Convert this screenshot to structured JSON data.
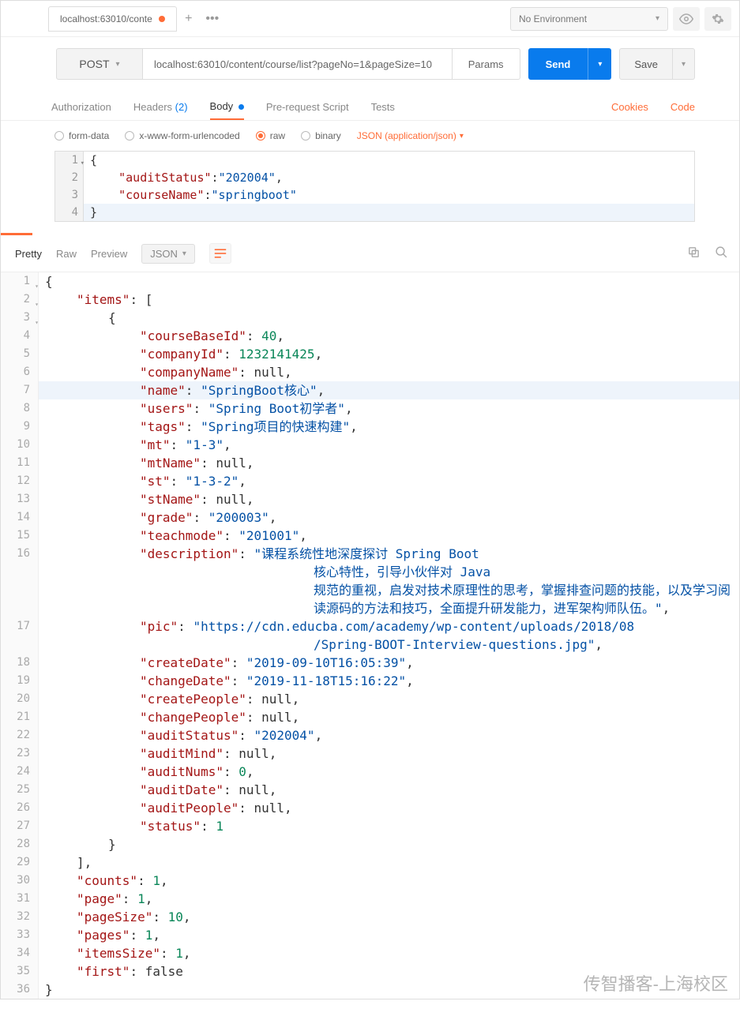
{
  "header": {
    "tab_title": "localhost:63010/conte",
    "env_label": "No Environment"
  },
  "request": {
    "method": "POST",
    "url": "localhost:63010/content/course/list?pageNo=1&pageSize=10",
    "params_label": "Params",
    "send_label": "Send",
    "save_label": "Save",
    "tabs": {
      "authorization": "Authorization",
      "headers": "Headers",
      "headers_count": "(2)",
      "body": "Body",
      "pre": "Pre-request Script",
      "tests": "Tests",
      "cookies": "Cookies",
      "code": "Code"
    },
    "body_types": {
      "formdata": "form-data",
      "xwww": "x-www-form-urlencoded",
      "raw": "raw",
      "binary": "binary",
      "ctype": "JSON (application/json)"
    },
    "raw_body_lines": {
      "l1": "{",
      "l2a": "\"auditStatus\"",
      "l2b": "\"202004\"",
      "l3a": "\"courseName\"",
      "l3b": "\"springboot\"",
      "l4": "}"
    }
  },
  "response_toolbar": {
    "pretty": "Pretty",
    "raw": "Raw",
    "preview": "Preview",
    "json": "JSON"
  },
  "response": {
    "l2_key": "\"items\"",
    "l4_key": "\"courseBaseId\"",
    "l4_val": "40",
    "l5_key": "\"companyId\"",
    "l5_val": "1232141425",
    "l6_key": "\"companyName\"",
    "l6_val": "null",
    "l7_key": "\"name\"",
    "l7_val": "\"SpringBoot核心\"",
    "l8_key": "\"users\"",
    "l8_val": "\"Spring Boot初学者\"",
    "l9_key": "\"tags\"",
    "l9_val": "\"Spring项目的快速构建\"",
    "l10_key": "\"mt\"",
    "l10_val": "\"1-3\"",
    "l11_key": "\"mtName\"",
    "l11_val": "null",
    "l12_key": "\"st\"",
    "l12_val": "\"1-3-2\"",
    "l13_key": "\"stName\"",
    "l13_val": "null",
    "l14_key": "\"grade\"",
    "l14_val": "\"200003\"",
    "l15_key": "\"teachmode\"",
    "l15_val": "\"201001\"",
    "l16_key": "\"description\"",
    "l16_val_a": "\"课程系统性地深度探讨 Spring Boot",
    "l16_val_b": "核心特性，引导小伙伴对 Java",
    "l16_val_c": "规范的重视，启发对技术原理性的思考，掌握排查问题的技能，以及学习阅",
    "l16_val_d": "读源码的方法和技巧，全面提升研发能力，进军架构师队伍。\"",
    "l17_key": "\"pic\"",
    "l17_val_a": "\"https://cdn.educba.com/academy/wp-content/uploads/2018/08",
    "l17_val_b": "/Spring-BOOT-Interview-questions.jpg\"",
    "l18_key": "\"createDate\"",
    "l18_val": "\"2019-09-10T16:05:39\"",
    "l19_key": "\"changeDate\"",
    "l19_val": "\"2019-11-18T15:16:22\"",
    "l20_key": "\"createPeople\"",
    "l20_val": "null",
    "l21_key": "\"changePeople\"",
    "l21_val": "null",
    "l22_key": "\"auditStatus\"",
    "l22_val": "\"202004\"",
    "l23_key": "\"auditMind\"",
    "l23_val": "null",
    "l24_key": "\"auditNums\"",
    "l24_val": "0",
    "l25_key": "\"auditDate\"",
    "l25_val": "null",
    "l26_key": "\"auditPeople\"",
    "l26_val": "null",
    "l27_key": "\"status\"",
    "l27_val": "1",
    "l30_key": "\"counts\"",
    "l30_val": "1",
    "l31_key": "\"page\"",
    "l31_val": "1",
    "l32_key": "\"pageSize\"",
    "l32_val": "10",
    "l33_key": "\"pages\"",
    "l33_val": "1",
    "l34_key": "\"itemsSize\"",
    "l34_val": "1",
    "l35_key": "\"first\"",
    "l35_val": "false"
  },
  "watermark": "传智播客-上海校区"
}
